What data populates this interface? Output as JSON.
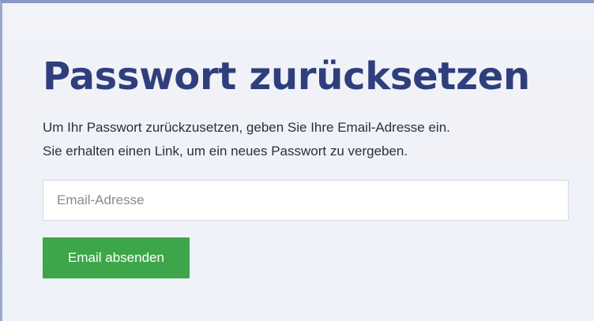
{
  "form": {
    "title": "Passwort zurücksetzen",
    "description_line1": "Um Ihr Passwort zurückzusetzen, geben Sie Ihre Email-Adresse ein.",
    "description_line2": "Sie erhalten einen Link, um ein neues Passwort zu vergeben.",
    "email_placeholder": "Email-Adresse",
    "email_value": "",
    "submit_label": "Email absenden"
  },
  "colors": {
    "title": "#2f3f7c",
    "button": "#3ea64a",
    "background": "#f1f3f9",
    "accent_border": "#8a98c7"
  }
}
